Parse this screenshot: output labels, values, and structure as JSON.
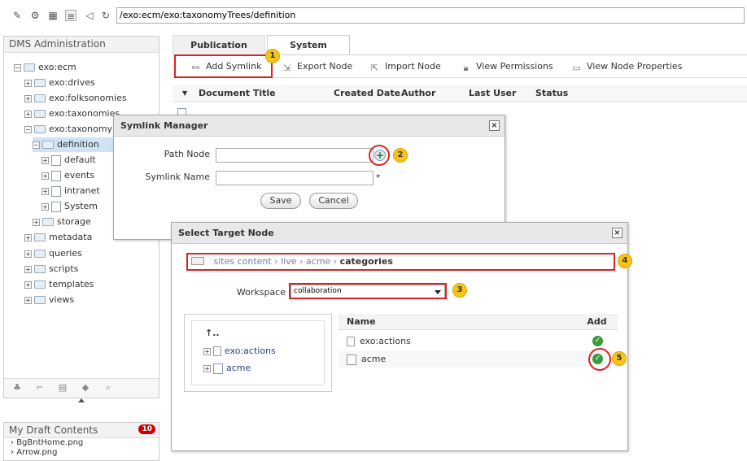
{
  "toolbar": {
    "icons": [
      "edit-icon",
      "gear-icon",
      "grid-icon",
      "list-icon",
      "back-icon",
      "refresh-icon"
    ],
    "address": "/exo:ecm/exo:taxonomyTrees/definition"
  },
  "sidebar": {
    "title": "DMS Administration",
    "tree": [
      {
        "label": "exo:ecm"
      },
      {
        "label": "exo:drives"
      },
      {
        "label": "exo:folksonomies"
      },
      {
        "label": "exo:taxonomies"
      },
      {
        "label": "exo:taxonomy"
      },
      {
        "label": "definition"
      },
      {
        "label": "default"
      },
      {
        "label": "events"
      },
      {
        "label": "intranet"
      },
      {
        "label": "System"
      },
      {
        "label": "storage"
      },
      {
        "label": "metadata"
      },
      {
        "label": "queries"
      },
      {
        "label": "scripts"
      },
      {
        "label": "templates"
      },
      {
        "label": "views"
      }
    ]
  },
  "drafts": {
    "title": "My Draft Contents",
    "count": "10",
    "items": [
      "BgBntHome.png",
      "Arrow.png"
    ]
  },
  "tabs": [
    {
      "label": "Publication"
    },
    {
      "label": "System"
    }
  ],
  "actions": [
    {
      "label": "Add Symlink"
    },
    {
      "label": "Export Node"
    },
    {
      "label": "Import Node"
    },
    {
      "label": "View Permissions"
    },
    {
      "label": "View Node Properties"
    }
  ],
  "list": {
    "columns": [
      "Document Title",
      "Created Date",
      "Author",
      "Last User",
      "Status"
    ]
  },
  "symlink_dialog": {
    "title": "Symlink Manager",
    "path_label": "Path Node",
    "name_label": "Symlink Name",
    "required_mark": "*",
    "save": "Save",
    "cancel": "Cancel"
  },
  "target_dialog": {
    "title": "Select Target Node",
    "breadcrumb": [
      "sites content",
      "live",
      "acme",
      "categories"
    ],
    "workspace_label": "Workspace",
    "workspace_value": "collaboration",
    "tree_root": "..",
    "tree_items": [
      "exo:actions",
      "acme"
    ],
    "table_headers": {
      "name": "Name",
      "add": "Add"
    },
    "rows": [
      {
        "name": "exo:actions"
      },
      {
        "name": "acme"
      }
    ]
  },
  "callouts": [
    "1",
    "2",
    "3",
    "4",
    "5"
  ],
  "colors": {
    "callout": "#dd2222",
    "badge": "#f7c51a",
    "check": "#3a9b3a",
    "breadcrumb": "#6b7fa6"
  }
}
